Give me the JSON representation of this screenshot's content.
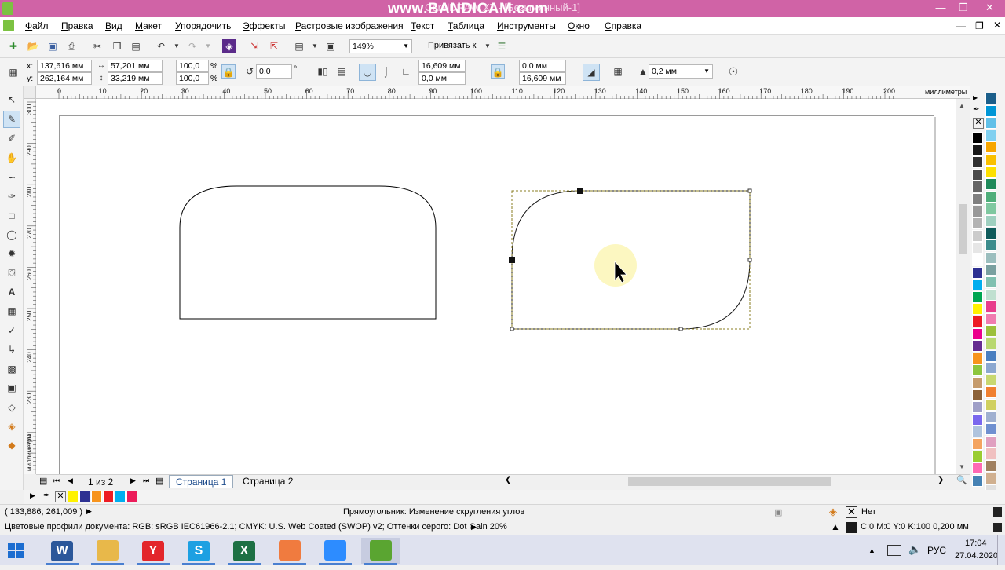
{
  "window": {
    "title": "CorelDRAW X7 - [Безымянный-1]",
    "watermark": "www.BANDICAM.com"
  },
  "menu": [
    "Файл",
    "Правка",
    "Вид",
    "Макет",
    "Упорядочить",
    "Эффекты",
    "Растровые изображения",
    "Текст",
    "Таблица",
    "Инструменты",
    "Окно",
    "Справка"
  ],
  "toolbar": {
    "zoom": "149%",
    "snap_label": "Привязать к"
  },
  "property_bar": {
    "x": "137,616 мм",
    "y": "262,164 мм",
    "width": "57,201 мм",
    "height": "33,219 мм",
    "scale_x": "100,0",
    "scale_y": "100,0",
    "percent": "%",
    "rotation": "0,0",
    "degree": "°",
    "corner_tl": "16,609 мм",
    "corner_bl": "0,0 мм",
    "corner_tr": "0,0 мм",
    "corner_br": "16,609 мм",
    "outline_width": "0,2 мм",
    "x_label": "x:",
    "y_label": "y:"
  },
  "ruler": {
    "h_labels": [
      "0",
      "10",
      "20",
      "30",
      "40",
      "50",
      "60",
      "70",
      "80",
      "90",
      "100",
      "110",
      "120",
      "130",
      "140",
      "150",
      "160",
      "170",
      "180",
      "190",
      "200"
    ],
    "unit": "миллиметры",
    "v_labels": [
      "300",
      "290",
      "280",
      "270",
      "260",
      "250",
      "240",
      "230",
      "220"
    ],
    "v_unit": "миллиметры"
  },
  "pages": {
    "counter": "1 из 2",
    "tabs": [
      "Страница 1",
      "Страница 2"
    ]
  },
  "status": {
    "coords": "( 133,886; 261,009 )",
    "message": "Прямоугольник: Изменение скругления углов",
    "color_profile": "Цветовые профили документа: RGB: sRGB IEC61966-2.1; CMYK: U.S. Web Coated (SWOP) v2; Оттенки серого: Dot Gain 20%",
    "fill": "Нет",
    "outline": "C:0 M:0 Y:0 K:100  0,200 мм"
  },
  "taskbar": {
    "lang": "РУС",
    "time": "17:04",
    "date": "27.04.2020",
    "apps": [
      {
        "name": "word",
        "label": "W",
        "color": "#2b579a"
      },
      {
        "name": "explorer",
        "label": "",
        "color": "#e8b84a"
      },
      {
        "name": "yandex",
        "label": "Y",
        "color": "#e3262b"
      },
      {
        "name": "skype",
        "label": "S",
        "color": "#1da0e2"
      },
      {
        "name": "excel",
        "label": "X",
        "color": "#1d7044"
      },
      {
        "name": "app-orange",
        "label": "",
        "color": "#f07b3f"
      },
      {
        "name": "zoom",
        "label": "",
        "color": "#2d8cff"
      },
      {
        "name": "coreldraw",
        "label": "",
        "color": "#5aa531"
      }
    ]
  },
  "colors": {
    "title_bg": "#d063a6",
    "taskbar_bg": "#dfe2ef",
    "palette": [
      "#000000",
      "#1a1a1a",
      "#333333",
      "#4d4d4d",
      "#666666",
      "#808080",
      "#999999",
      "#b3b3b3",
      "#cccccc",
      "#e6e6e6",
      "#ffffff",
      "#2e3192",
      "#00aeef",
      "#00a651",
      "#fff200",
      "#ed1c24",
      "#ec008c",
      "#662d91",
      "#f7941d",
      "#8dc63f",
      "#c69c6d",
      "#8c6239",
      "#a0a0c8",
      "#7b68ee",
      "#b0c4de",
      "#f4a460",
      "#9acd32",
      "#ff69b4",
      "#4682b4",
      "#d2691e",
      "#20b2aa",
      "#ffd700",
      "#c71585"
    ],
    "palette2": [
      "#1b5e8a",
      "#0096d6",
      "#60c0e8",
      "#80d0f0",
      "#f7a600",
      "#f9c000",
      "#fde000",
      "#1f8a5a",
      "#4fae7a",
      "#7fc8a0",
      "#9fd0c0",
      "#0f5b5b",
      "#3c8c8c",
      "#9bbebe",
      "#7aa0a0",
      "#80c0b0",
      "#c0e0d0",
      "#e83d8c",
      "#f07cb0",
      "#9cc03c",
      "#b8d870",
      "#4a7fc0",
      "#8ca8d0",
      "#c8d870",
      "#f08030",
      "#d0d060",
      "#a0b0d0",
      "#7090d0",
      "#e0a0c0",
      "#f0c0c0",
      "#a08060",
      "#d0b090",
      "#8070a0"
    ],
    "doc_palette": [
      "#fff200",
      "#2e3192",
      "#f7941d",
      "#ed1c24",
      "#00aeef",
      "#ec1c5a"
    ]
  }
}
